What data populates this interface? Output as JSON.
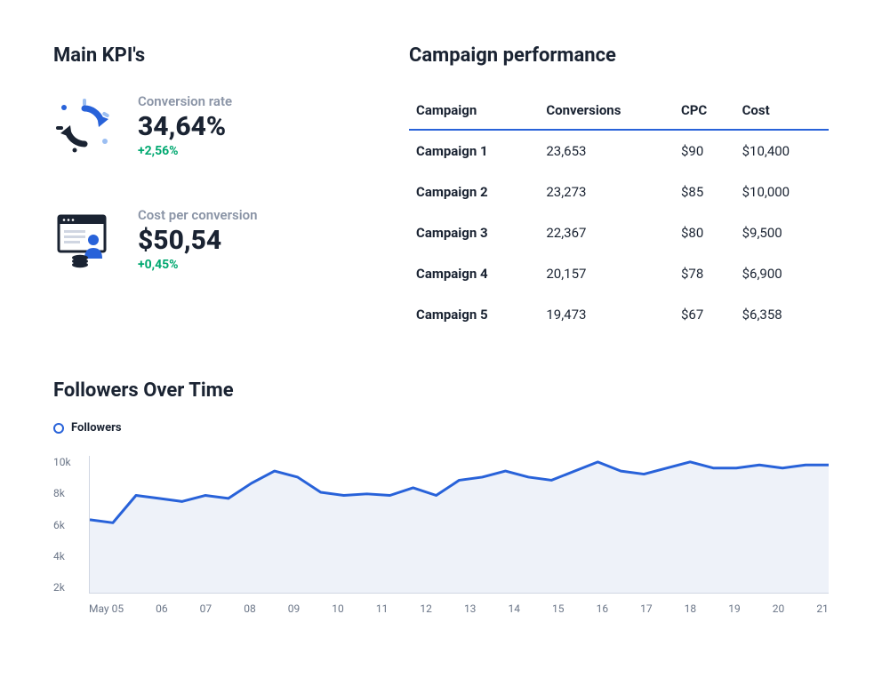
{
  "kpi": {
    "title": "Main KPI's",
    "cards": [
      {
        "label": "Conversion rate",
        "value": "34,64%",
        "delta": "+2,56%"
      },
      {
        "label": "Cost per conversion",
        "value": "$50,54",
        "delta": "+0,45%"
      }
    ]
  },
  "campaign": {
    "title": "Campaign performance",
    "headers": [
      "Campaign",
      "Conversions",
      "CPC",
      "Cost"
    ],
    "rows": [
      {
        "name": "Campaign 1",
        "conversions": "23,653",
        "cpc": "$90",
        "cost": "$10,400"
      },
      {
        "name": "Campaign 2",
        "conversions": "23,273",
        "cpc": "$85",
        "cost": "$10,000"
      },
      {
        "name": "Campaign 3",
        "conversions": "22,367",
        "cpc": "$80",
        "cost": "$9,500"
      },
      {
        "name": "Campaign 4",
        "conversions": "20,157",
        "cpc": "$78",
        "cost": "$6,900"
      },
      {
        "name": "Campaign 5",
        "conversions": "19,473",
        "cpc": "$67",
        "cost": "$6,358"
      }
    ]
  },
  "chart": {
    "title": "Followers Over Time",
    "legend": "Followers"
  },
  "chart_data": {
    "type": "area",
    "title": "Followers Over Time",
    "xlabel": "",
    "ylabel": "",
    "ylim": [
      2000,
      10000
    ],
    "y_ticks": [
      "10k",
      "8k",
      "6k",
      "4k",
      "2k"
    ],
    "x_ticks": [
      "May 05",
      "06",
      "07",
      "08",
      "09",
      "10",
      "11",
      "12",
      "13",
      "14",
      "15",
      "16",
      "17",
      "18",
      "19",
      "20",
      "21"
    ],
    "series": [
      {
        "name": "Followers",
        "color": "#2862d9",
        "x": [
          "May 05",
          "05.5",
          "06",
          "06.5",
          "07",
          "07.5",
          "08",
          "08.5",
          "09",
          "09.5",
          "10",
          "10.5",
          "11",
          "11.5",
          "12",
          "12.5",
          "13",
          "13.5",
          "14",
          "14.5",
          "15",
          "15.5",
          "16",
          "16.5",
          "17",
          "17.5",
          "18",
          "18.5",
          "19",
          "19.5",
          "20",
          "20.5",
          "21"
        ],
        "values": [
          6800,
          6600,
          8400,
          8200,
          8000,
          8400,
          8200,
          9200,
          10000,
          9600,
          8600,
          8400,
          8500,
          8400,
          8900,
          8400,
          9400,
          9600,
          10000,
          9600,
          9400,
          10000,
          10600,
          10000,
          9800,
          10200,
          10600,
          10200,
          10200,
          10400,
          10200,
          10400,
          10400
        ]
      }
    ]
  }
}
